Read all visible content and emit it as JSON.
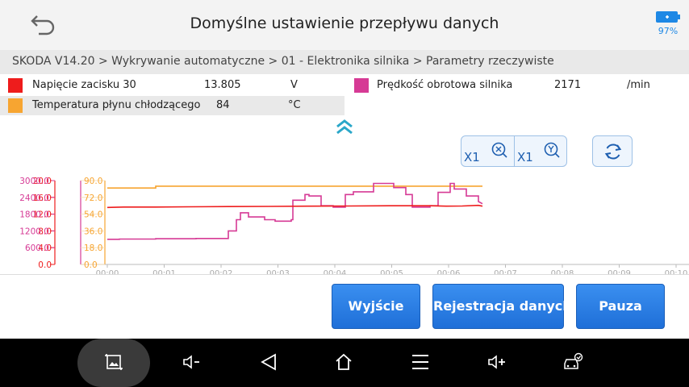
{
  "header": {
    "title": "Domyślne ustawienie przepływu danych",
    "battery_percent": "97%",
    "battery_color": "#1e88e5"
  },
  "breadcrumb": "SKODA V14.20 > Wykrywanie automatyczne  > 01 - Elektronika silnika > Parametry rzeczywiste",
  "params": [
    {
      "name": "Napięcie zacisku 30",
      "value": "13.805",
      "unit": "V",
      "color": "#ee1c1c"
    },
    {
      "name": "Prędkość obrotowa silnika",
      "value": "2171",
      "unit": "/min",
      "color": "#d63a95"
    },
    {
      "name": "Temperatura płynu chłodzącego",
      "value": "84",
      "unit": "°C",
      "color": "#f7a531"
    }
  ],
  "zoom": {
    "x_label": "X1",
    "y_label": "X1"
  },
  "buttons": {
    "exit": "Wyjście",
    "record": "Rejestracja danych",
    "pause": "Pauza"
  },
  "chart_data": {
    "type": "line",
    "x_ticks": [
      "00:00",
      "00:01",
      "00:02",
      "00:03",
      "00:04",
      "00:05",
      "00:06",
      "00:07",
      "00:08",
      "00:09",
      "00:10"
    ],
    "axes": [
      {
        "series": "Napięcie zacisku 30",
        "color": "#ee1c1c",
        "ticks": [
          "20.0",
          "16.0",
          "12.0",
          "8.0",
          "4.0",
          "0.0"
        ],
        "ylim": [
          0,
          20
        ]
      },
      {
        "series": "Prędkość obrotowa silnika",
        "color": "#d63a95",
        "ticks": [
          "3000.0",
          "2400.0",
          "1800.0",
          "1200.0",
          "600.0"
        ],
        "ylim": [
          0,
          3000
        ]
      },
      {
        "series": "Temperatura płynu chłodzącego",
        "color": "#f7a531",
        "ticks": [
          "90.0",
          "72.0",
          "54.0",
          "36.0",
          "18.0",
          "0.0"
        ],
        "ylim": [
          0,
          90
        ]
      }
    ],
    "series": [
      {
        "name": "Napięcie zacisku 30",
        "color": "#ee1c1c",
        "x": [
          0,
          20,
          60,
          100,
          150,
          200,
          250,
          300,
          350,
          400,
          420,
          440,
          460,
          465
        ],
        "y": [
          13.6,
          13.7,
          13.7,
          13.75,
          13.8,
          13.85,
          13.9,
          13.95,
          14.0,
          14.0,
          13.9,
          13.95,
          14.1,
          13.9
        ]
      },
      {
        "name": "Prędkość obrotowa silnika",
        "color": "#d63a95",
        "x": [
          0,
          15,
          15,
          60,
          60,
          110,
          110,
          150,
          150,
          160,
          160,
          165,
          165,
          175,
          175,
          195,
          195,
          208,
          208,
          228,
          228,
          230,
          230,
          245,
          245,
          250,
          250,
          265,
          265,
          280,
          280,
          295,
          295,
          305,
          305,
          330,
          330,
          355,
          355,
          370,
          370,
          378,
          378,
          400,
          400,
          410,
          410,
          425,
          425,
          430,
          430,
          445,
          445,
          460,
          460,
          465
        ],
        "y": [
          900,
          900,
          910,
          910,
          920,
          920,
          930,
          930,
          1200,
          1200,
          1600,
          1600,
          1850,
          1850,
          1700,
          1700,
          1600,
          1600,
          1550,
          1550,
          1600,
          1600,
          2300,
          2300,
          2500,
          2500,
          2450,
          2450,
          2100,
          2100,
          2050,
          2050,
          2500,
          2500,
          2600,
          2600,
          2900,
          2900,
          2750,
          2750,
          2500,
          2500,
          2050,
          2050,
          2100,
          2100,
          2580,
          2580,
          2900,
          2900,
          2700,
          2700,
          2450,
          2450,
          2250,
          2171
        ]
      },
      {
        "name": "Temperatura płynu chłodzącego",
        "color": "#f7a531",
        "x": [
          0,
          60,
          60,
          465
        ],
        "y": [
          82,
          82,
          84,
          84
        ]
      }
    ]
  }
}
